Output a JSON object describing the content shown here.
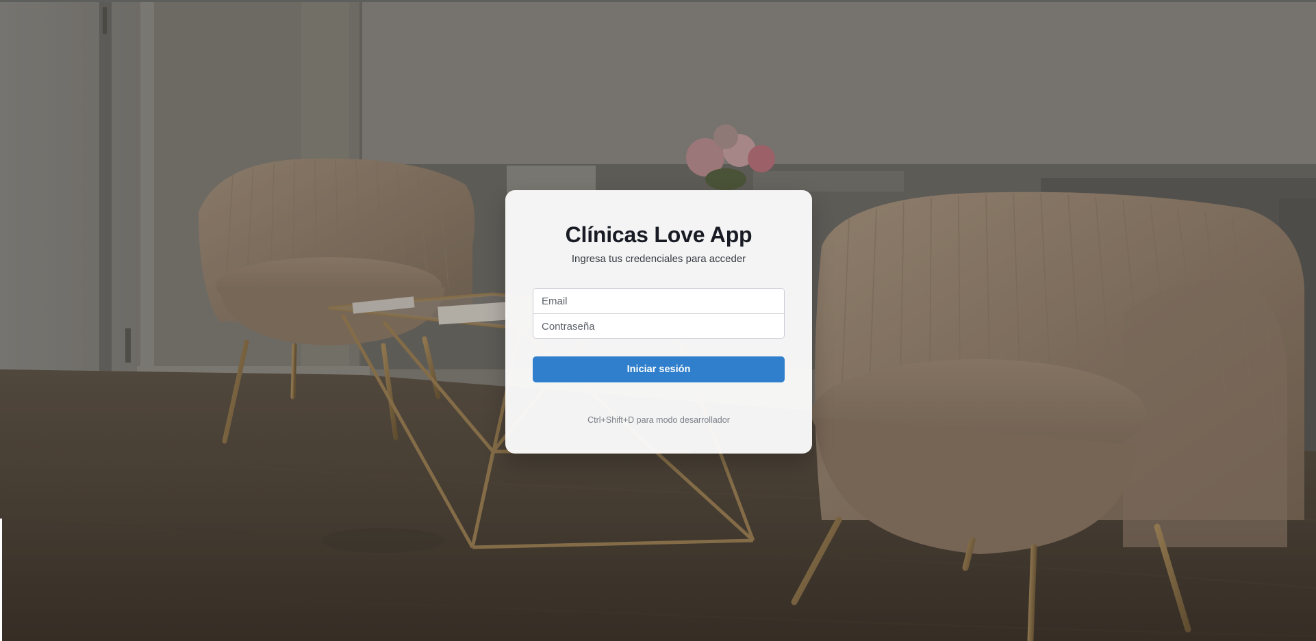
{
  "login": {
    "title": "Clínicas Love App",
    "subtitle": "Ingresa tus credenciales para acceder",
    "email": {
      "placeholder": "Email",
      "value": ""
    },
    "password": {
      "placeholder": "Contraseña",
      "value": ""
    },
    "submit_label": "Iniciar sesión",
    "dev_hint": "Ctrl+Shift+D para modo desarrollador"
  },
  "colors": {
    "primary_button": "#2f7fcc",
    "title_text": "#191b24",
    "card_background": "#fafafa",
    "photo_overlay": "#6e6962"
  },
  "background": {
    "description_icon": "waiting-room-photo"
  }
}
